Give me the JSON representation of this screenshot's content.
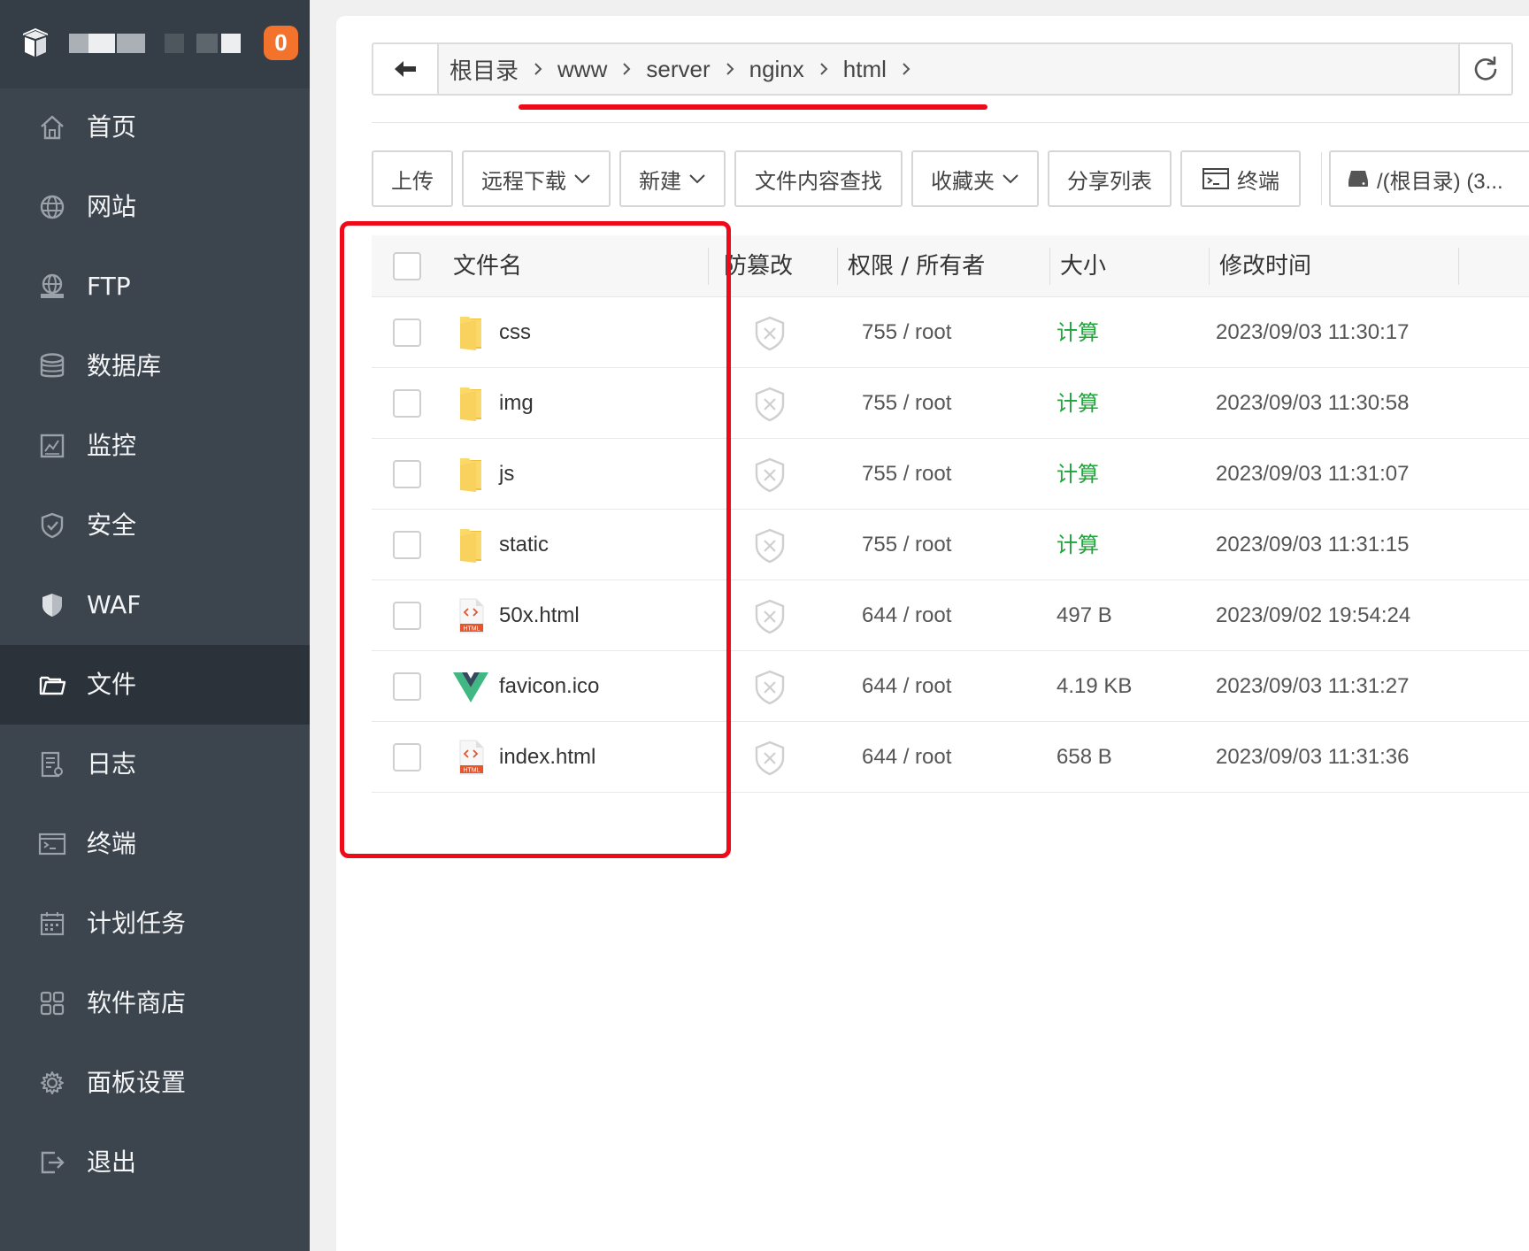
{
  "sidebar": {
    "badge_count": "0",
    "items": [
      {
        "label": "首页",
        "icon": "home-icon"
      },
      {
        "label": "网站",
        "icon": "globe-icon"
      },
      {
        "label": "FTP",
        "icon": "ftp-icon"
      },
      {
        "label": "数据库",
        "icon": "database-icon"
      },
      {
        "label": "监控",
        "icon": "monitor-icon"
      },
      {
        "label": "安全",
        "icon": "shield-check-icon"
      },
      {
        "label": "WAF",
        "icon": "waf-shield-icon"
      },
      {
        "label": "文件",
        "icon": "folder-icon",
        "active": true
      },
      {
        "label": "日志",
        "icon": "log-icon"
      },
      {
        "label": "终端",
        "icon": "terminal-icon"
      },
      {
        "label": "计划任务",
        "icon": "calendar-icon"
      },
      {
        "label": "软件商店",
        "icon": "apps-grid-icon"
      },
      {
        "label": "面板设置",
        "icon": "gear-icon"
      },
      {
        "label": "退出",
        "icon": "logout-icon"
      }
    ]
  },
  "breadcrumb": {
    "items": [
      "根目录",
      "www",
      "server",
      "nginx",
      "html"
    ]
  },
  "toolbar": {
    "upload": "上传",
    "remote_download": "远程下载",
    "new": "新建",
    "content_search": "文件内容查找",
    "favorites": "收藏夹",
    "share_list": "分享列表",
    "terminal": "终端",
    "disk": "/(根目录) (3..."
  },
  "table": {
    "headers": {
      "name": "文件名",
      "tamper": "防篡改",
      "perm_owner": "权限 / 所有者",
      "size": "大小",
      "mtime": "修改时间"
    },
    "rows": [
      {
        "name": "css",
        "type": "folder",
        "perm": "755 / root",
        "size": "计算",
        "size_is_link": true,
        "mtime": "2023/09/03 11:30:17"
      },
      {
        "name": "img",
        "type": "folder",
        "perm": "755 / root",
        "size": "计算",
        "size_is_link": true,
        "mtime": "2023/09/03 11:30:58"
      },
      {
        "name": "js",
        "type": "folder",
        "perm": "755 / root",
        "size": "计算",
        "size_is_link": true,
        "mtime": "2023/09/03 11:31:07"
      },
      {
        "name": "static",
        "type": "folder",
        "perm": "755 / root",
        "size": "计算",
        "size_is_link": true,
        "mtime": "2023/09/03 11:31:15"
      },
      {
        "name": "50x.html",
        "type": "html",
        "perm": "644 / root",
        "size": "497 B",
        "size_is_link": false,
        "mtime": "2023/09/02 19:54:24"
      },
      {
        "name": "favicon.ico",
        "type": "vue",
        "perm": "644 / root",
        "size": "4.19 KB",
        "size_is_link": false,
        "mtime": "2023/09/03 11:31:27"
      },
      {
        "name": "index.html",
        "type": "html",
        "perm": "644 / root",
        "size": "658 B",
        "size_is_link": false,
        "mtime": "2023/09/03 11:31:36"
      }
    ]
  },
  "colors": {
    "sidebar_bg": "#3c444d",
    "sidebar_active": "#2b3239",
    "badge": "#f3722c",
    "highlight_red": "#ee0a18",
    "link_green": "#20a53a",
    "folder_yellow": "#f8d25c"
  }
}
